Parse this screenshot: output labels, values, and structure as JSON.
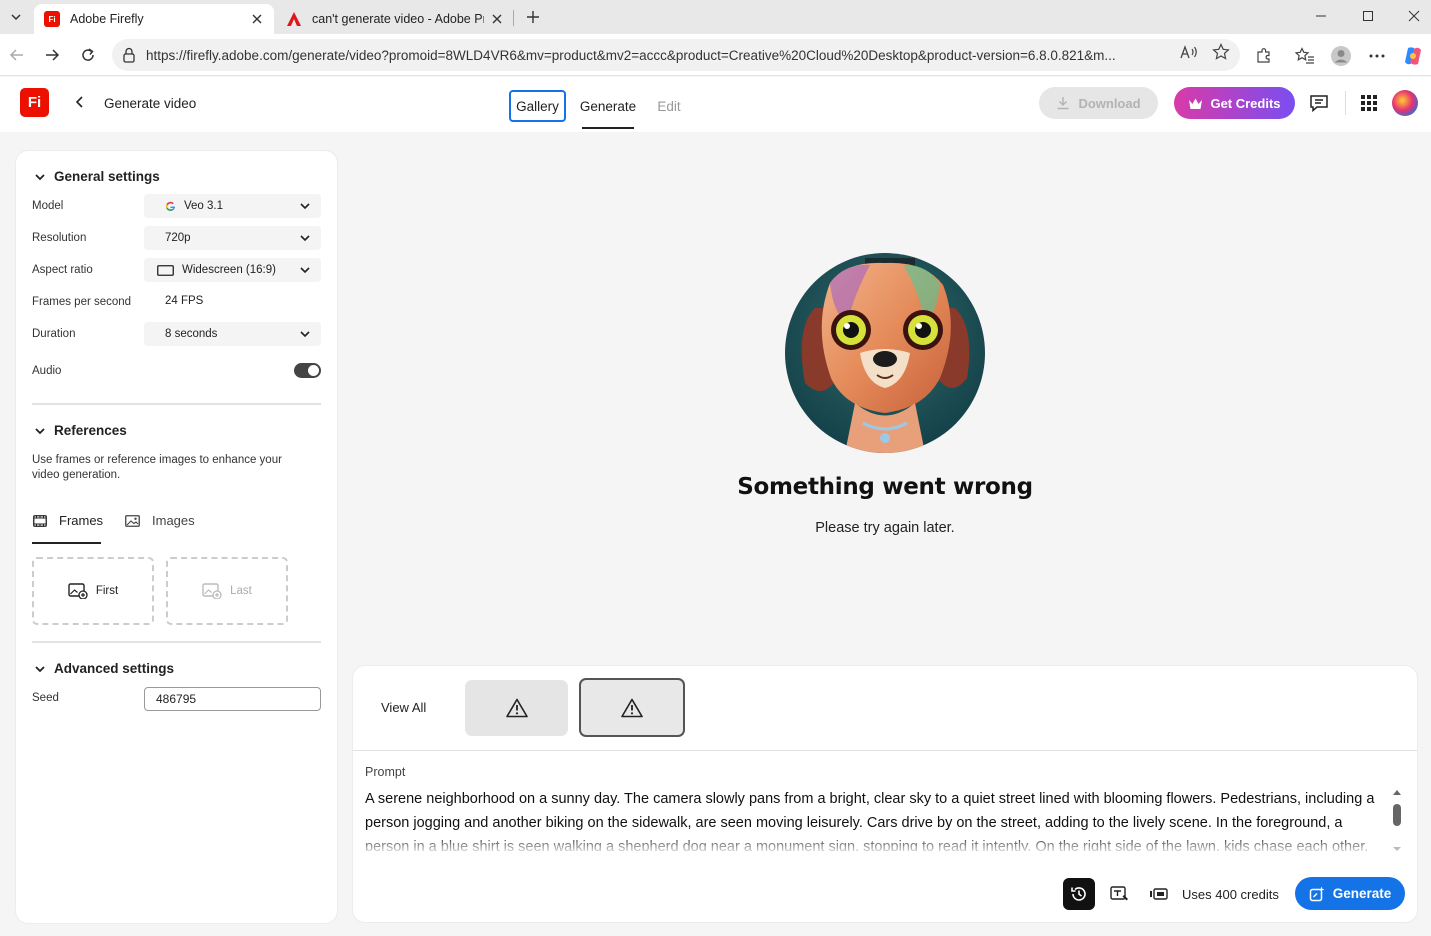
{
  "browser": {
    "tabs": [
      {
        "title": "Adobe Firefly",
        "active": true
      },
      {
        "title": "can't generate video - Adobe Pro",
        "active": false
      }
    ],
    "url": "https://firefly.adobe.com/generate/video?promoid=8WLD4VR6&mv=product&mv2=accc&product=Creative%20Cloud%20Desktop&product-version=6.8.0.821&m..."
  },
  "header": {
    "logo_text": "Fi",
    "page_title": "Generate video",
    "tabs": {
      "gallery": "Gallery",
      "generate": "Generate",
      "edit": "Edit"
    },
    "download_label": "Download",
    "credits_label": "Get Credits"
  },
  "general_settings": {
    "title": "General settings",
    "model_label": "Model",
    "model_value": "Veo 3.1",
    "resolution_label": "Resolution",
    "resolution_value": "720p",
    "aspect_label": "Aspect ratio",
    "aspect_value": "Widescreen (16:9)",
    "fps_label": "Frames per second",
    "fps_value": "24 FPS",
    "duration_label": "Duration",
    "duration_value": "8 seconds",
    "audio_label": "Audio",
    "audio_on": true
  },
  "references": {
    "title": "References",
    "description": "Use frames or reference images to enhance your video generation.",
    "tab_frames": "Frames",
    "tab_images": "Images",
    "slot_first": "First",
    "slot_last": "Last"
  },
  "advanced_settings": {
    "title": "Advanced settings",
    "seed_label": "Seed",
    "seed_value": "486795"
  },
  "error": {
    "title": "Something went wrong",
    "subtitle": "Please try again later."
  },
  "bottom": {
    "view_all": "View All",
    "prompt_label": "Prompt",
    "prompt_text": "A serene neighborhood on a sunny day. The camera slowly pans from a bright, clear sky to a quiet street lined with blooming flowers. Pedestrians, including a person jogging and another biking on the sidewalk, are seen moving leisurely. Cars drive by on the street, adding to the lively scene. In the foreground, a person in a blue shirt is seen walking a shepherd dog near a monument sign, stopping to read it intently. On the right side of the lawn, kids chase each other.",
    "uses_credits": "Uses 400 credits",
    "generate_label": "Generate"
  },
  "colors": {
    "accent": "#1473e6",
    "brand": "#eb1000",
    "credits_gradient_start": "#d93aa8",
    "credits_gradient_end": "#7a4ef0"
  }
}
